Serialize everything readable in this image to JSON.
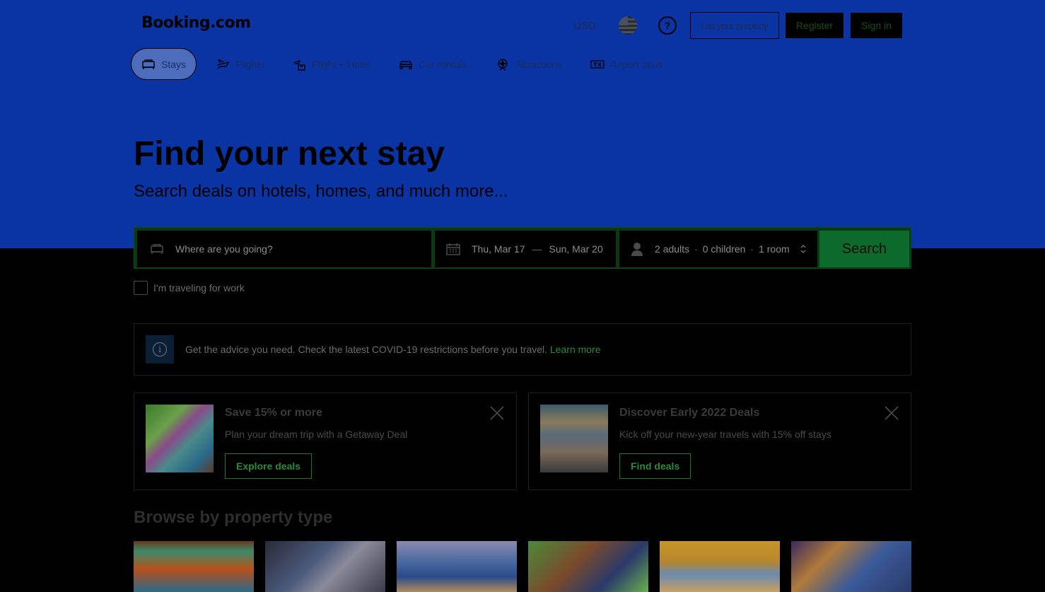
{
  "header": {
    "logo": "Booking.com",
    "currency": "USD",
    "list_property": "List your property",
    "register": "Register",
    "sign_in": "Sign in",
    "help_glyph": "?"
  },
  "nav": {
    "tabs": [
      {
        "label": "Stays",
        "icon": "bed-icon",
        "active": true
      },
      {
        "label": "Flights",
        "icon": "plane-icon"
      },
      {
        "label": "Flight + Hotel",
        "icon": "flight-hotel-icon"
      },
      {
        "label": "Car rentals",
        "icon": "car-icon"
      },
      {
        "label": "Attractions",
        "icon": "attractions-icon"
      },
      {
        "label": "Airport taxis",
        "icon": "taxi-icon"
      }
    ]
  },
  "hero": {
    "title": "Find your next stay",
    "subtitle": "Search deals on hotels, homes, and much more..."
  },
  "search": {
    "destination_placeholder": "Where are you going?",
    "checkin": "Thu, Mar 17",
    "dash": "—",
    "checkout": "Sun, Mar 20",
    "adults": "2 adults",
    "children": "0 children",
    "rooms": "1 room",
    "dot": "·",
    "button": "Search",
    "work_label": "I'm traveling for work"
  },
  "covid": {
    "info_glyph": "i",
    "text": "Get the advice you need. Check the latest COVID-19 restrictions before you travel.",
    "link": "Learn more"
  },
  "deals": [
    {
      "title": "Save 15% or more",
      "description": "Plan your dream trip with a Getaway Deal",
      "button": "Explore deals"
    },
    {
      "title": "Discover Early 2022 Deals",
      "description": "Kick off your new-year travels with 15% off stays",
      "button": "Find deals"
    }
  ],
  "browse": {
    "title": "Browse by property type"
  },
  "colors": {
    "header_bg": "#0a34a3",
    "search_button": "#0c6a2c",
    "link": "#2a8a3a"
  }
}
